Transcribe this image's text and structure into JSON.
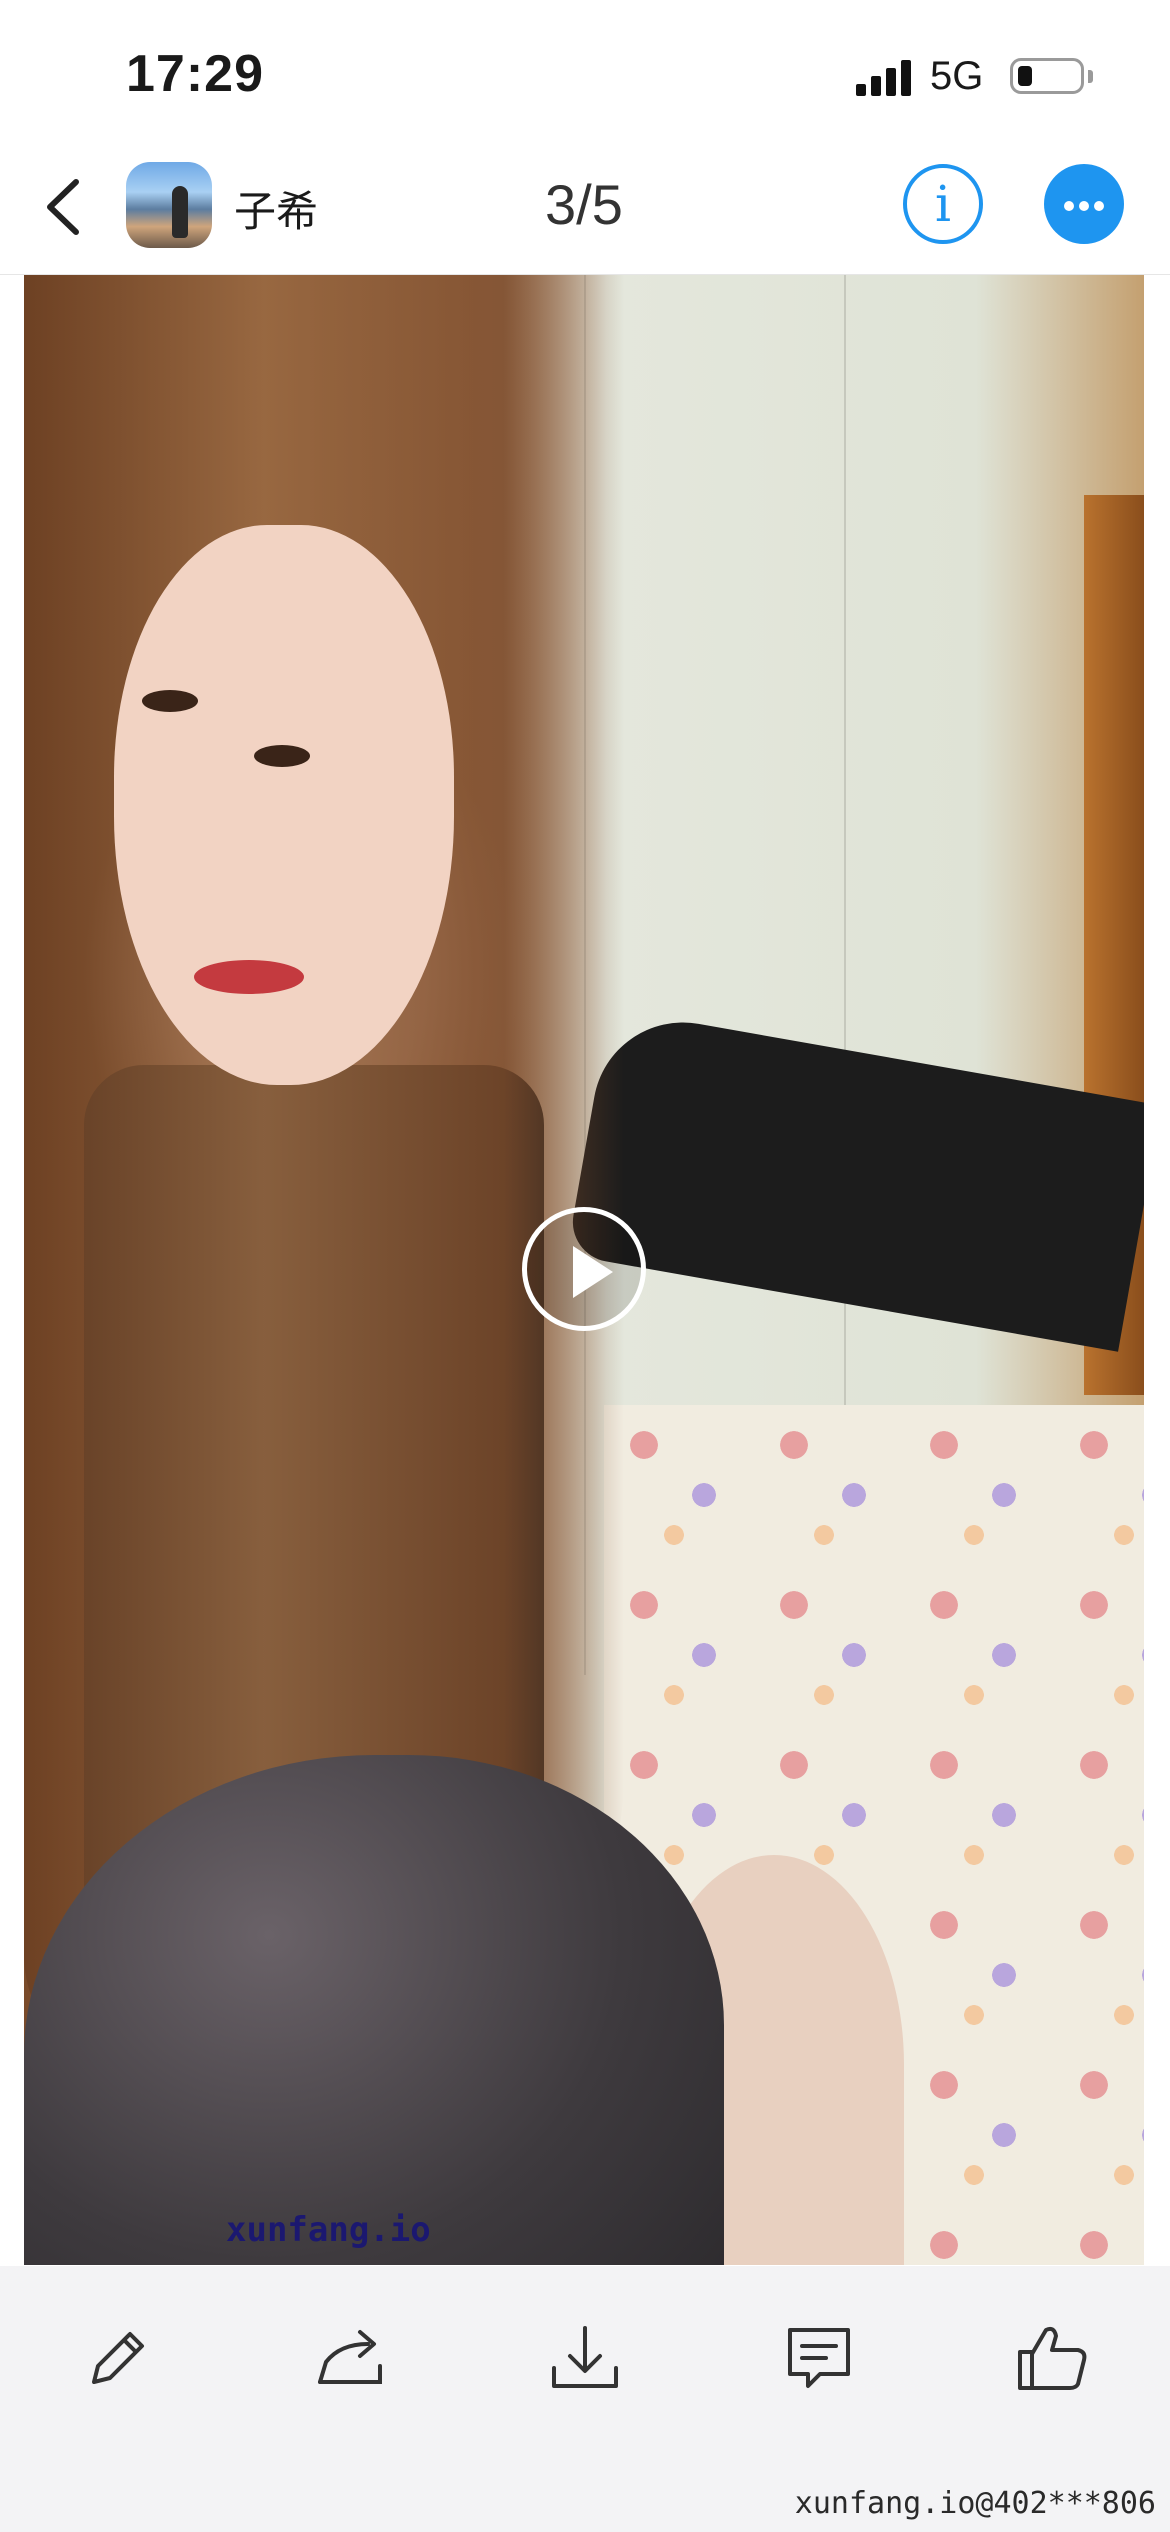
{
  "status_bar": {
    "time": "17:29",
    "network": "5G",
    "battery_level": 0.2
  },
  "nav": {
    "back_icon": "chevron-left-icon",
    "user_name": "子希",
    "page_counter": "3/5",
    "info_icon": "info-icon",
    "more_icon": "more-icon",
    "accent_color": "#1e95f0"
  },
  "media": {
    "type": "video",
    "play_icon": "play-icon",
    "watermark": "xunfang.io"
  },
  "toolbar": {
    "items": [
      {
        "icon": "pencil-icon"
      },
      {
        "icon": "share-icon"
      },
      {
        "icon": "download-icon"
      },
      {
        "icon": "comment-icon"
      },
      {
        "icon": "thumbs-up-icon"
      }
    ]
  },
  "footer": {
    "watermark": "xunfang.io@402***806"
  }
}
